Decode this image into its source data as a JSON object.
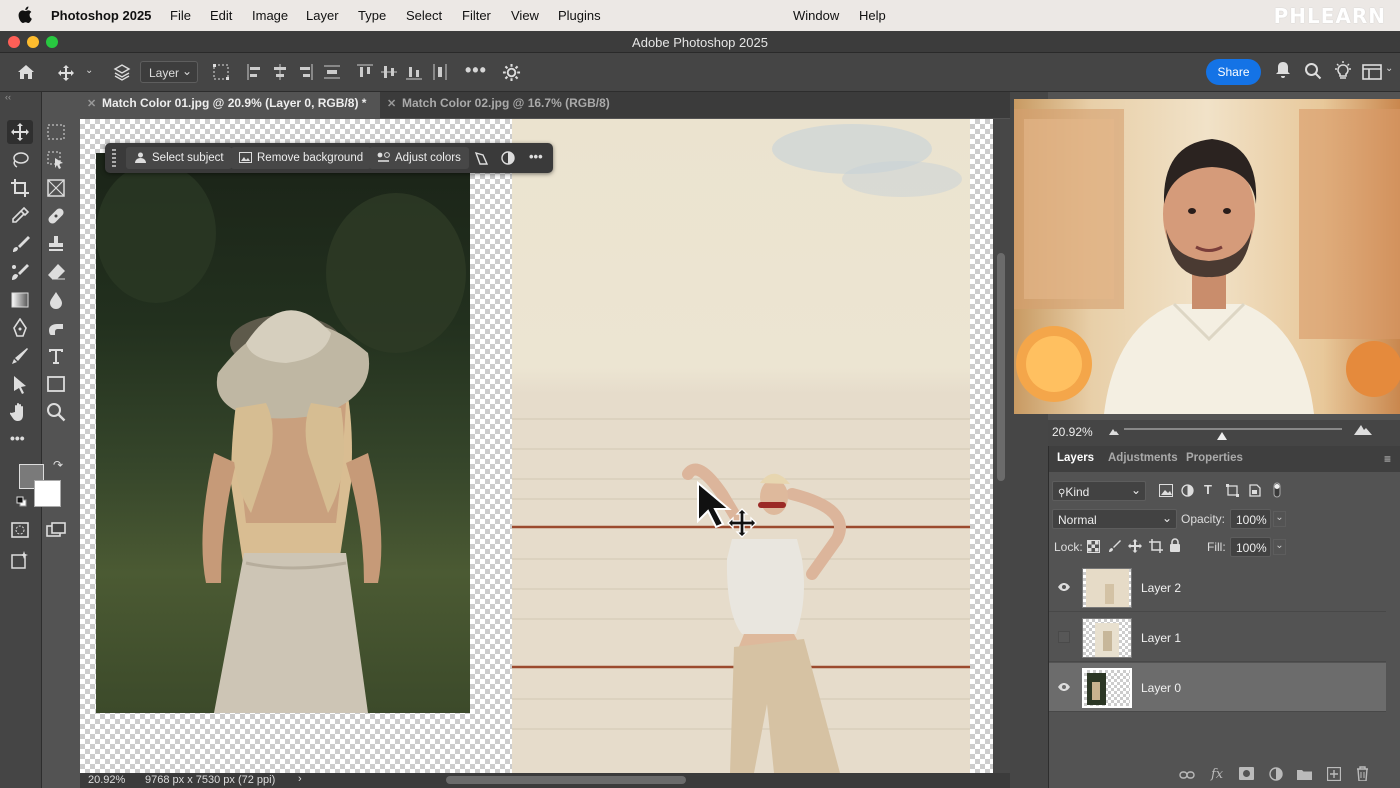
{
  "menubar": {
    "app_name": "Photoshop 2025",
    "items": [
      "File",
      "Edit",
      "Image",
      "Layer",
      "Type",
      "Select",
      "Filter",
      "View",
      "Plugins",
      "Window",
      "Help"
    ],
    "watermark": "PHLEARN"
  },
  "window": {
    "title": "Adobe Photoshop 2025"
  },
  "options_bar": {
    "auto_select_target": "Layer",
    "share_label": "Share"
  },
  "tabs": [
    {
      "label": "Match Color 01.jpg @ 20.9% (Layer 0, RGB/8) *",
      "active": true
    },
    {
      "label": "Match Color 02.jpg @ 16.7% (RGB/8)",
      "active": false
    }
  ],
  "contextual_bar": {
    "select_subject": "Select subject",
    "remove_background": "Remove background",
    "adjust_colors": "Adjust colors"
  },
  "status_bar": {
    "zoom": "20.92%",
    "doc_size": "9768 px x 7530 px (72 ppi)"
  },
  "navigator": {
    "zoom": "20.92%",
    "zoom_level": 0.45
  },
  "layers_panel": {
    "tabs": [
      "Layers",
      "Adjustments",
      "Properties"
    ],
    "filter_kind": "Kind",
    "blend_mode": "Normal",
    "opacity_label": "Opacity:",
    "opacity": "100%",
    "lock_label": "Lock:",
    "fill_label": "Fill:",
    "fill": "100%",
    "layers": [
      {
        "name": "Layer 2",
        "visible": true,
        "selected": false
      },
      {
        "name": "Layer 1",
        "visible": false,
        "selected": false
      },
      {
        "name": "Layer 0",
        "visible": true,
        "selected": true
      }
    ]
  },
  "colors": {
    "accent": "#1473e6",
    "foreground": "#7a7a7a",
    "background": "#ffffff"
  }
}
